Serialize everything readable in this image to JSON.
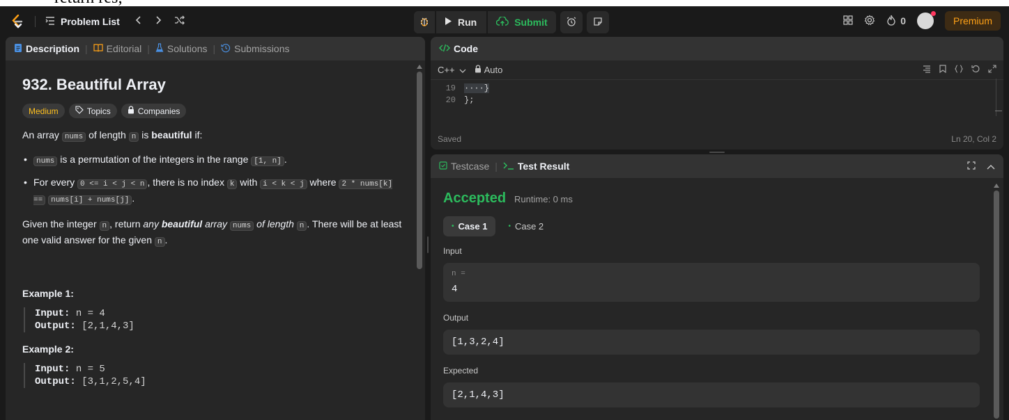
{
  "header_cut_text": "return res;",
  "nav": {
    "problem_list": "Problem List",
    "run": "Run",
    "submit": "Submit",
    "streak": "0",
    "premium": "Premium"
  },
  "description": {
    "tabs": [
      "Description",
      "Editorial",
      "Solutions",
      "Submissions"
    ],
    "title": "932. Beautiful Array",
    "badges": {
      "difficulty": "Medium",
      "topics": "Topics",
      "companies": "Companies"
    },
    "intro": {
      "a": "An array",
      "nums": "nums",
      "b": "of length",
      "n": "n",
      "c": "is",
      "beautiful": "beautiful",
      "d": "if:"
    },
    "bullet1": {
      "nums": "nums",
      "text": "is a permutation of the integers in the range",
      "range": "[1, n]",
      "end": "."
    },
    "bullet2": {
      "a": "For every",
      "c1": "0 <= i < j < n",
      "b": ", there is no index",
      "c2": "k",
      "c": "with",
      "c3": "i < k < j",
      "d": "where",
      "c4": "2 * nums[k] ==",
      "c5": "nums[i] + nums[j]",
      "e": "."
    },
    "given": {
      "a": "Given the integer",
      "n": "n",
      "b": ", return",
      "any": "any",
      "beautiful": "beautiful",
      "array": "array",
      "nums": "nums",
      "of": "of length",
      "n2": "n",
      "c": ". There will be at least one valid answer for the given",
      "n3": "n",
      "d": "."
    },
    "example1": {
      "title": "Example 1:",
      "input_label": "Input:",
      "input": "n = 4",
      "output_label": "Output:",
      "output": "[2,1,4,3]"
    },
    "example2": {
      "title": "Example 2:",
      "input_label": "Input:",
      "input": "n = 5",
      "output_label": "Output:",
      "output": "[3,1,2,5,4]"
    }
  },
  "code": {
    "title": "Code",
    "language": "C++",
    "mode": "Auto",
    "lines": [
      {
        "num": "19",
        "text": "····}"
      },
      {
        "num": "20",
        "text": "};"
      }
    ],
    "status_left": "Saved",
    "status_right": "Ln 20, Col 2"
  },
  "result": {
    "tabs": [
      "Testcase",
      "Test Result"
    ],
    "status": "Accepted",
    "runtime": "Runtime: 0 ms",
    "cases": [
      "Case 1",
      "Case 2"
    ],
    "input_label": "Input",
    "input_var": "n =",
    "input_value": "4",
    "output_label": "Output",
    "output_value": "[1,3,2,4]",
    "expected_label": "Expected",
    "expected_value": "[2,1,4,3]"
  },
  "colors": {
    "accent_green": "#2cbb5d",
    "medium": "#ffc01e",
    "premium": "#ffa116",
    "tab_blue": "#4a90e2"
  }
}
